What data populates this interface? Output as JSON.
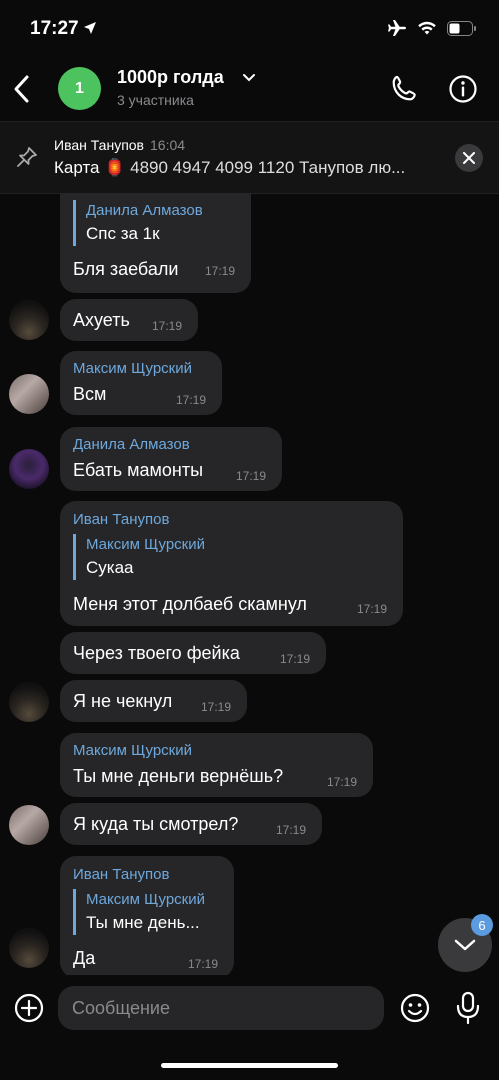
{
  "status": {
    "time": "17:27"
  },
  "header": {
    "avatar_letter": "1",
    "title": "1000р голда",
    "subtitle": "3 участника"
  },
  "pinned": {
    "author": "Иван Танупов",
    "time": "16:04",
    "text_lead": "Карта 🏮",
    "text_rest": " 4890 4947 4099 1120 Танупов лю..."
  },
  "messages": [
    {
      "quote_sender": "Данила Алмазов",
      "quote_text": "Спс за 1к",
      "text": "Бля заебали",
      "time": "17:19"
    },
    {
      "text": "Ахуеть",
      "time": "17:19"
    },
    {
      "sender": "Максим Щурский",
      "text": "Всм",
      "time": "17:19"
    },
    {
      "sender": "Данила Алмазов",
      "text": "Ебать мамонты",
      "time": "17:19"
    },
    {
      "sender": "Иван Танупов",
      "quote_sender": "Максим Щурский",
      "quote_text": "Сукаа",
      "text": "Меня этот долбаеб скамнул",
      "time": "17:19"
    },
    {
      "text": "Через твоего фейка",
      "time": "17:19"
    },
    {
      "text": "Я не чекнул",
      "time": "17:19"
    },
    {
      "sender": "Максим Щурский",
      "text": "Ты мне деньги вернёшь?",
      "time": "17:19"
    },
    {
      "text": "Я куда ты смотрел?",
      "time": "17:19"
    },
    {
      "sender": "Иван Танупов",
      "quote_sender": "Максим Щурский",
      "quote_text": "Ты мне день...",
      "text": "Да",
      "time": "17:19"
    }
  ],
  "scroll_badge": "6",
  "input": {
    "placeholder": "Сообщение"
  }
}
